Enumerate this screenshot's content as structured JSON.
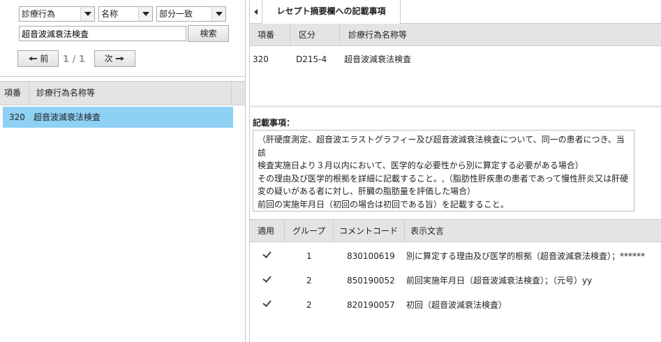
{
  "search": {
    "category": "診療行為",
    "field": "名称",
    "match": "部分一致",
    "query": "超音波減衰法検査",
    "search_label": "検索",
    "prev_label": "前",
    "next_label": "次",
    "page": "1 / 1"
  },
  "left_list": {
    "headers": [
      "項番",
      "診療行為名称等"
    ],
    "rows": [
      {
        "no": "320",
        "name": "超音波減衰法検査"
      }
    ]
  },
  "tab": {
    "title": "レセプト摘要欄への記載事項"
  },
  "detail": {
    "headers": [
      "項番",
      "区分",
      "診療行為名称等"
    ],
    "row": {
      "no": "320",
      "kubun": "D215-4",
      "name": "超音波減衰法検査"
    }
  },
  "note": {
    "label": "記載事項：",
    "text": "（肝硬度測定、超音波エラストグラフィー及び超音波減衰法検査について、同一の患者につき、当該\n検査実施日より３月以内において、医学的な必要性から別に算定する必要がある場合）\nその理由及び医学的根拠を詳細に記載すること。,（脂肪性肝疾患の患者であって慢性肝炎又は肝硬\n変の疑いがある者に対し、肝臓の脂肪量を評価した場合）\n前回の実施年月日（初回の場合は初回である旨）を記載すること。"
  },
  "comments": {
    "headers": [
      "適用",
      "グループ",
      "コメントコード",
      "表示文言"
    ],
    "rows": [
      {
        "group": "1",
        "code": "830100619",
        "text": "別に算定する理由及び医学的根拠（超音波減衰法検査）；******"
      },
      {
        "group": "2",
        "code": "850190052",
        "text": "前回実施年月日（超音波減衰法検査）；（元号）yy"
      },
      {
        "group": "2",
        "code": "820190057",
        "text": "初回（超音波減衰法検査）"
      }
    ]
  }
}
